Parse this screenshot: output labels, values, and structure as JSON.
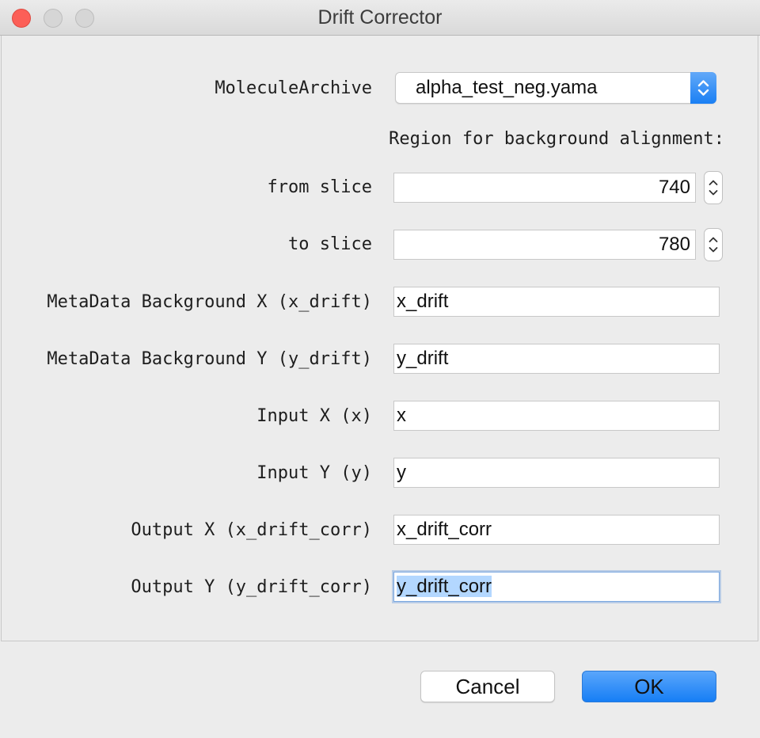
{
  "window": {
    "title": "Drift Corrector"
  },
  "form": {
    "archive_label": "MoleculeArchive",
    "archive_value": "alpha_test_neg.yama",
    "region_label": "Region for background alignment:",
    "from_slice_label": "from slice",
    "from_slice_value": "740",
    "to_slice_label": "to slice",
    "to_slice_value": "780",
    "bg_x_label": "MetaData Background X (x_drift)",
    "bg_x_value": "x_drift",
    "bg_y_label": "MetaData Background Y (y_drift)",
    "bg_y_value": "y_drift",
    "input_x_label": "Input X (x)",
    "input_x_value": "x",
    "input_y_label": "Input Y (y)",
    "input_y_value": "y",
    "output_x_label": "Output X (x_drift_corr)",
    "output_x_value": "x_drift_corr",
    "output_y_label": "Output Y (y_drift_corr)",
    "output_y_value": "y_drift_corr"
  },
  "buttons": {
    "cancel": "Cancel",
    "ok": "OK"
  },
  "icons": {
    "close": "close-icon",
    "minimize": "minimize-icon",
    "zoom": "zoom-icon",
    "select_arrows": "chevron-up-down-icon",
    "stepper": "stepper-arrows-icon"
  },
  "colors": {
    "accent": "#1a7ff4",
    "close": "#fc5f57",
    "selection": "#b3d7ff"
  }
}
